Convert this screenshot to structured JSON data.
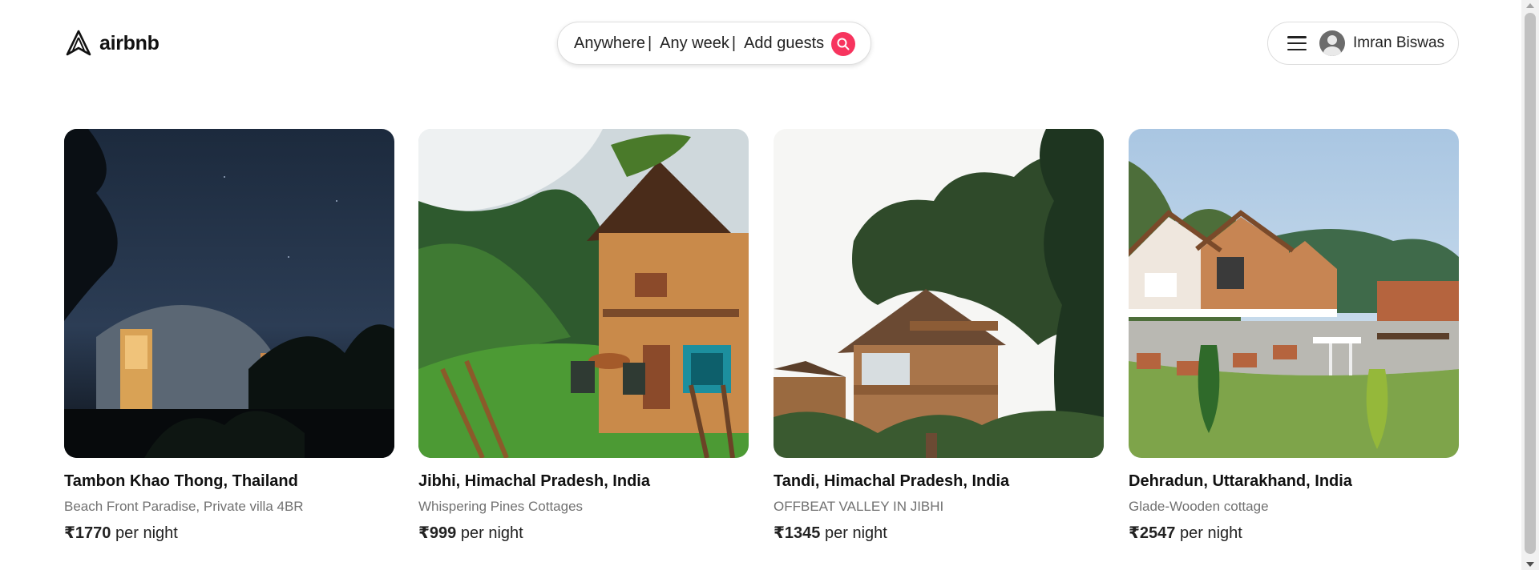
{
  "header": {
    "logo_text": "airbnb",
    "logo_icon": "airbnb-logo-icon",
    "search": {
      "where": "Anywhere",
      "when": "Any week",
      "who": "Add guests",
      "separator": "|",
      "button_icon": "search-icon",
      "accent_color": "#f7345e"
    },
    "user": {
      "menu_icon": "hamburger-menu-icon",
      "avatar_icon": "user-avatar-icon",
      "name": "Imran Biswas"
    }
  },
  "listings": [
    {
      "location": "Tambon Khao Thong, Thailand",
      "description": "Beach Front Paradise, Private villa 4BR",
      "price": "₹1770",
      "price_suffix": "per night"
    },
    {
      "location": "Jibhi, Himachal Pradesh, India",
      "description": "Whispering Pines Cottages",
      "price": "₹999",
      "price_suffix": "per night"
    },
    {
      "location": "Tandi, Himachal Pradesh, India",
      "description": "OFFBEAT VALLEY IN JIBHI",
      "price": "₹1345",
      "price_suffix": "per night"
    },
    {
      "location": "Dehradun, Uttarakhand, India",
      "description": "Glade-Wooden cottage",
      "price": "₹2547",
      "price_suffix": "per night"
    }
  ]
}
